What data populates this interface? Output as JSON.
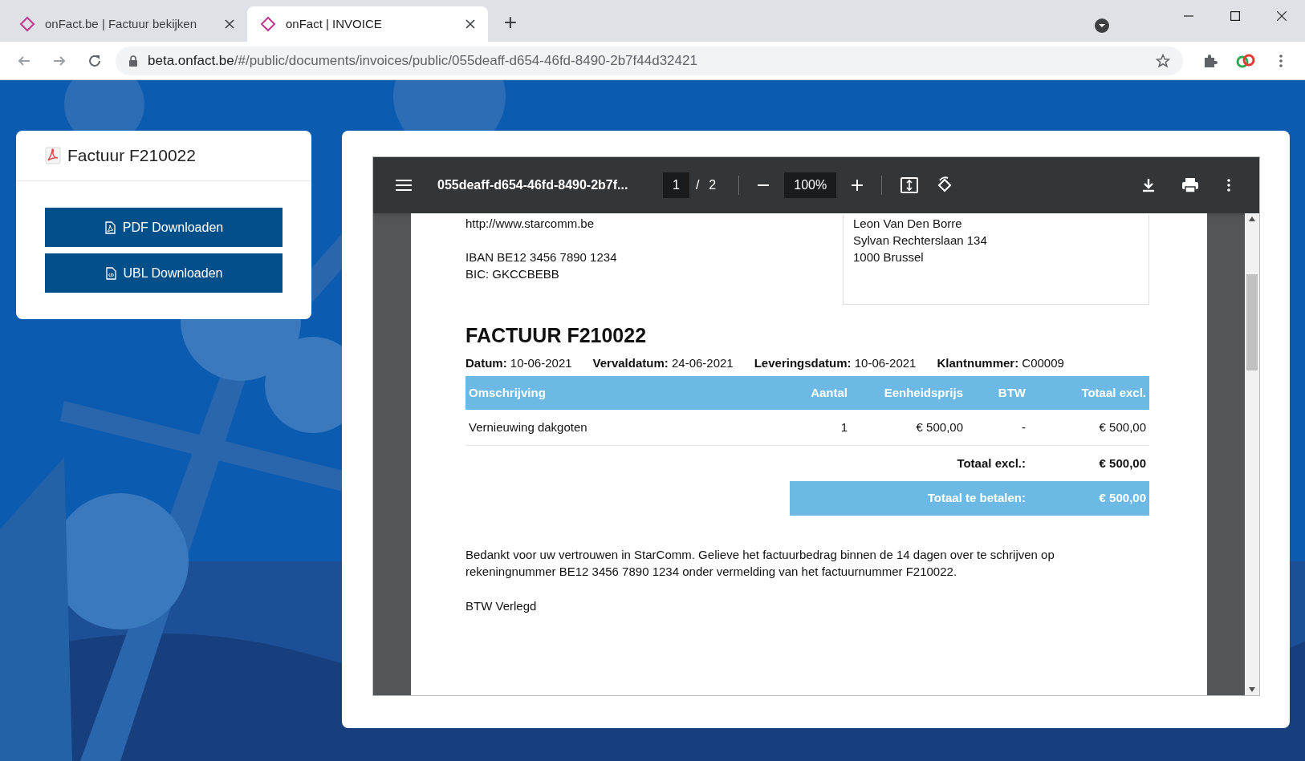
{
  "browser": {
    "tabs": [
      {
        "title": "onFact.be | Factuur bekijken",
        "selected": false
      },
      {
        "title": "onFact | INVOICE",
        "selected": true
      }
    ],
    "new_tab": "+",
    "url_host": "beta.onfact.be",
    "url_path": "/#/public/documents/invoices/public/055deaff-d654-46fd-8490-2b7f44d32421"
  },
  "sidebar_card": {
    "title": "Factuur F210022",
    "buttons": [
      {
        "label": "PDF Downloaden",
        "kind": "pdf"
      },
      {
        "label": "UBL Downloaden",
        "kind": "ubl"
      }
    ]
  },
  "pdf_viewer": {
    "filename": "055deaff-d654-46fd-8490-2b7f...",
    "page": "1",
    "page_separator": "/",
    "page_count": "2",
    "zoom": "100%"
  },
  "document": {
    "sender_blocks": [
      [
        "http://www.starcomm.be"
      ],
      [
        "IBAN BE12 3456 7890 1234",
        "BIC: GKCCBEBB"
      ]
    ],
    "recipient_lines": [
      "Leon Van Den Borre",
      "Sylvan Rechterslaan 134",
      "1000 Brussel"
    ],
    "title": "FACTUUR F210022",
    "meta": [
      {
        "label": "Datum:",
        "value": "10-06-2021"
      },
      {
        "label": "Vervaldatum:",
        "value": "24-06-2021"
      },
      {
        "label": "Leveringsdatum:",
        "value": "10-06-2021"
      },
      {
        "label": "Klantnummer:",
        "value": "C00009"
      }
    ],
    "columns": [
      "Omschrijving",
      "Aantal",
      "Eenheidsprijs",
      "BTW",
      "Totaal excl."
    ],
    "rows": [
      [
        "Vernieuwing dakgoten",
        "1",
        "€ 500,00",
        "-",
        "€ 500,00"
      ]
    ],
    "totals": [
      {
        "label": "Totaal excl.:",
        "value": "€ 500,00",
        "kind": "subtotal"
      },
      {
        "label": "Totaal te betalen:",
        "value": "€ 500,00",
        "kind": "grand"
      }
    ],
    "note": "Bedankt voor uw vertrouwen in StarComm. Gelieve het factuurbedrag binnen de 14 dagen over te schrijven op rekeningnummer BE12 3456 7890 1234 onder vermelding van het factuurnummer F210022.",
    "vat_note": "BTW Verlegd"
  }
}
